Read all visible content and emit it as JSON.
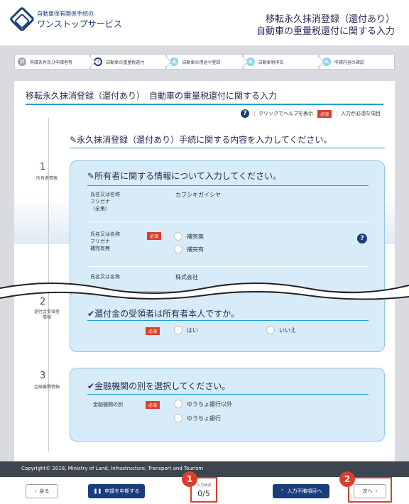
{
  "header": {
    "logo_small": "自動車保有関係手続の",
    "logo_big": "ワンストップサービス",
    "title_line1": "移転永久抹消登録（還付あり）",
    "title_line2": "自動車の重量税還付に関する入力"
  },
  "steps": [
    {
      "num": "済",
      "label": "申請条件及び申請者等",
      "state": "done"
    },
    {
      "num": "!",
      "label": "自動車の重量税還付",
      "state": "current"
    },
    {
      "num": "未",
      "label": "自動車の用途や登録",
      "state": "todo"
    },
    {
      "num": "未",
      "label": "自動車税申告",
      "state": "todo"
    },
    {
      "num": "未",
      "label": "申請内容の確認",
      "state": "todo"
    }
  ],
  "page": {
    "title": "移転永久抹消登録（還付あり）　自動車の重量税還付に関する入力",
    "help_text": "：クリックでヘルプを表示",
    "required_badge": "必須",
    "required_text": "：入力が必須な項目",
    "section_heading": "永久抹消登録（還付あり）手続に関する内容を入力してください。"
  },
  "timeline": [
    {
      "num": "1",
      "label": "所有者情報"
    },
    {
      "num": "2",
      "label": "還付金受領者情報"
    },
    {
      "num": "3",
      "label": "金融機関情報"
    }
  ],
  "card1": {
    "title": "所有者に関する情報について入力してください。",
    "row1_label": "氏名又は名称\nフリガナ\n（全角）",
    "row1_value": "カブシキガイシヤ",
    "row2_label": "氏名又は名称\nフリガナ\n補完有無",
    "row2_badge": "必須",
    "row2_opt1": "補完無",
    "row2_opt2": "補完有",
    "row3_label": "氏名又は名称",
    "row3_value": "株式会社"
  },
  "card2": {
    "title": "還付金の受領者は所有者本人ですか。",
    "badge": "必須",
    "opt1": "はい",
    "opt2": "いいえ"
  },
  "card3": {
    "title": "金融機関の別を選択してください。",
    "row_label": "金融機関の別",
    "badge": "必須",
    "opt1": "ゆうちょ銀行以外",
    "opt2": "ゆうちょ銀行"
  },
  "footer": {
    "copyright": "Copyright© 2018, Ministry of Land, Infrastructure, Transport and Tourism",
    "back_label": "戻る",
    "suspend_label": "申請を中断する",
    "counter_label": "入力状況",
    "counter_value": "0/5",
    "unset_label": "入力不備項目へ",
    "next_label": "次へ"
  },
  "callouts": [
    "1",
    "2"
  ],
  "colors": {
    "navy": "#1a3d7c",
    "accent": "#1f9ed1",
    "required": "#d9402b",
    "card": "#d7ebf8"
  }
}
